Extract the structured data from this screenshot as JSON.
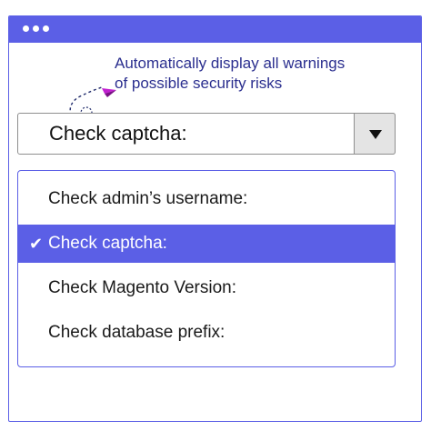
{
  "note": {
    "line1": "Automatically display all warnings",
    "line2": "of possible security risks"
  },
  "select": {
    "value": "Check captcha:"
  },
  "options": [
    {
      "label": "Check admin’s username:",
      "selected": false
    },
    {
      "label": "Check captcha:",
      "selected": true
    },
    {
      "label": "Check Magento Version:",
      "selected": false
    },
    {
      "label": "Check database prefix:",
      "selected": false
    }
  ],
  "colors": {
    "accent": "#5b5fe6",
    "note_text": "#2b2f8f",
    "plane": "#c11fd0"
  },
  "icons": {
    "window_dots": "three-dots-icon",
    "plane": "paper-plane-icon",
    "dropdown_arrow": "triangle-down-icon",
    "check": "checkmark-icon"
  }
}
